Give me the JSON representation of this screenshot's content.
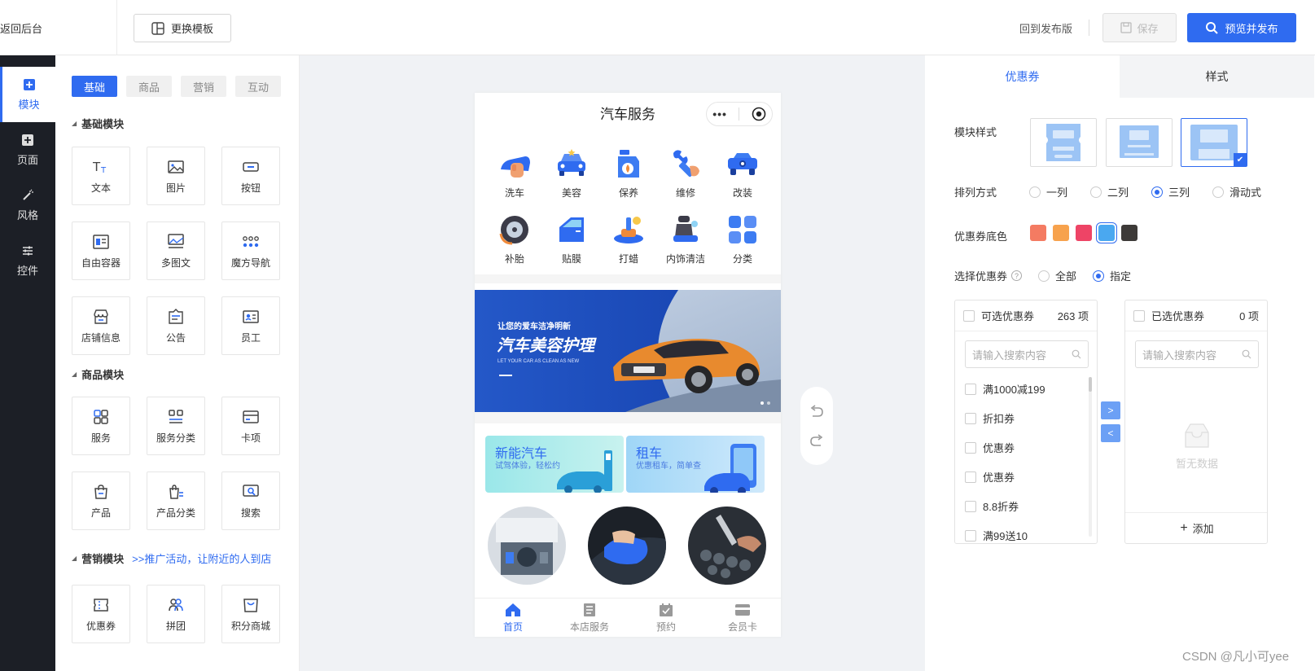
{
  "header": {
    "back_label": "返回后台",
    "template_label": "更换模板",
    "return_label": "回到发布版",
    "save_label": "保存",
    "publish_label": "预览并发布"
  },
  "sidenav": {
    "items": [
      {
        "label": "模块",
        "icon": "plus-square-icon"
      },
      {
        "label": "页面",
        "icon": "plus-square-icon"
      },
      {
        "label": "风格",
        "icon": "wand-icon"
      },
      {
        "label": "控件",
        "icon": "sliders-icon"
      }
    ]
  },
  "modules": {
    "tabs": [
      "基础",
      "商品",
      "营销",
      "互动"
    ],
    "basic_title": "基础模块",
    "basic_items": [
      "文本",
      "图片",
      "按钮",
      "自由容器",
      "多图文",
      "魔方导航",
      "店铺信息",
      "公告",
      "员工"
    ],
    "goods_title": "商品模块",
    "goods_items": [
      "服务",
      "服务分类",
      "卡项",
      "产品",
      "产品分类",
      "搜索"
    ],
    "marketing_title": "营销模块",
    "marketing_sub": ">>推广活动，让附近的人到店",
    "marketing_items": [
      "优惠券",
      "拼团",
      "积分商城"
    ]
  },
  "phone": {
    "title": "汽车服务",
    "services": [
      "洗车",
      "美容",
      "保养",
      "维修",
      "改装",
      "补胎",
      "贴膜",
      "打蜡",
      "内饰清洁",
      "分类"
    ],
    "banner": {
      "small": "让您的爱车洁净明新",
      "big": "汽车美容护理",
      "en": "LET YOUR CAR AS CLEAN AS NEW"
    },
    "promo": [
      {
        "title": "新能汽车",
        "sub": "试驾体验，轻松约"
      },
      {
        "title": "租车",
        "sub": "优惠租车，简单查"
      }
    ],
    "tabbar": [
      "首页",
      "本店服务",
      "预约",
      "会员卡"
    ]
  },
  "props": {
    "tabs": [
      "优惠券",
      "样式"
    ],
    "module_style_label": "模块样式",
    "layout_label": "排列方式",
    "layout_options": [
      "一列",
      "二列",
      "三列",
      "滑动式"
    ],
    "layout_selected": "三列",
    "color_label": "优惠券底色",
    "colors": [
      "#f47b62",
      "#f7a24d",
      "#ee4466",
      "#4aa8f0",
      "#3d3a38"
    ],
    "select_label": "选择优惠券",
    "select_options": [
      "全部",
      "指定"
    ],
    "select_selected": "指定",
    "available": {
      "title": "可选优惠券",
      "count": "263 项",
      "placeholder": "请输入搜索内容",
      "items": [
        "满1000减199",
        "折扣券",
        "优惠券",
        "优惠券",
        "8.8折券",
        "满99送10"
      ]
    },
    "selected": {
      "title": "已选优惠券",
      "count": "0 项",
      "placeholder": "请输入搜索内容",
      "empty_text": "暂无数据",
      "add_label": "添加"
    }
  },
  "watermark": "CSDN @凡小可yee"
}
